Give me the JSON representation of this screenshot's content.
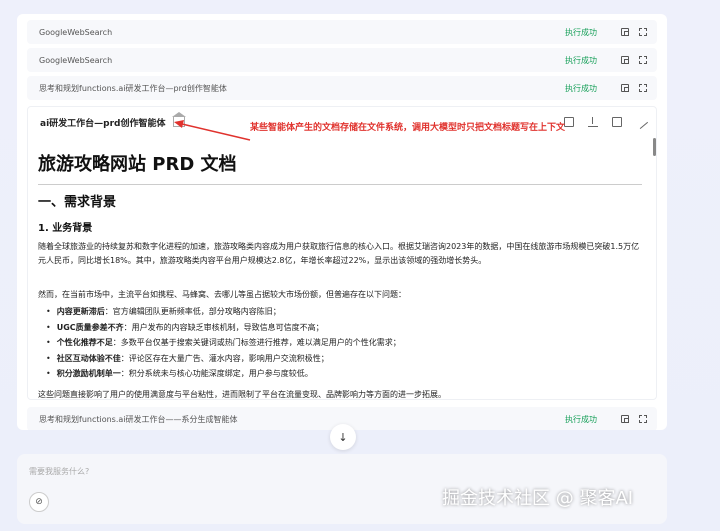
{
  "steps_top": [
    {
      "label": "GoogleWebSearch",
      "status": "执行成功"
    },
    {
      "label": "GoogleWebSearch",
      "status": "执行成功"
    },
    {
      "label": "思考和规划functions.ai研发工作台—prd创作智能体",
      "status": "执行成功"
    }
  ],
  "doc": {
    "title": "ai研发工作台—prd创作智能体",
    "annotation": "某些智能体产生的文档存储在文件系统，调用大模型时只把文档标题写在上下文",
    "h1": "旅游攻略网站 PRD 文档",
    "h2": "一、需求背景",
    "h3": "1. 业务背景",
    "para1": "随着全球旅游业的持续复苏和数字化进程的加速，旅游攻略类内容成为用户获取旅行信息的核心入口。根据艾瑞咨询2023年的数据，中国在线旅游市场规模已突破1.5万亿元人民币，同比增长18%。其中，旅游攻略类内容平台用户规模达2.8亿，年增长率超过22%，显示出该领域的强劲增长势头。",
    "para2": "然而，在当前市场中，主流平台如携程、马蜂窝、去哪儿等虽占据较大市场份额，但普遍存在以下问题：",
    "bullets": [
      {
        "bold": "内容更新滞后",
        "text": "：官方编辑团队更新频率低，部分攻略内容陈旧；"
      },
      {
        "bold": "UGC质量参差不齐",
        "text": "：用户发布的内容缺乏审核机制，导致信息可信度不高；"
      },
      {
        "bold": "个性化推荐不足",
        "text": "：多数平台仅基于搜索关键词或热门标签进行推荐，难以满足用户的个性化需求；"
      },
      {
        "bold": "社区互动体验不佳",
        "text": "：评论区存在大量广告、灌水内容，影响用户交流积极性；"
      },
      {
        "bold": "积分激励机制单一",
        "text": "：积分系统未与核心功能深度绑定，用户参与度较低。"
      }
    ],
    "para3": "这些问题直接影响了用户的使用满意度与平台粘性，进而限制了平台在流量变现、品牌影响力等方面的进一步拓展。"
  },
  "step_bottom": {
    "label": "思考和规划functions.ai研发工作台——系分生成智能体",
    "status": "执行成功"
  },
  "input": {
    "placeholder": "需要我服务什么?"
  },
  "scroll_down_symbol": "↓",
  "attach_symbol": "⊘",
  "watermark": "掘金技术社区 @ 聚客AI"
}
